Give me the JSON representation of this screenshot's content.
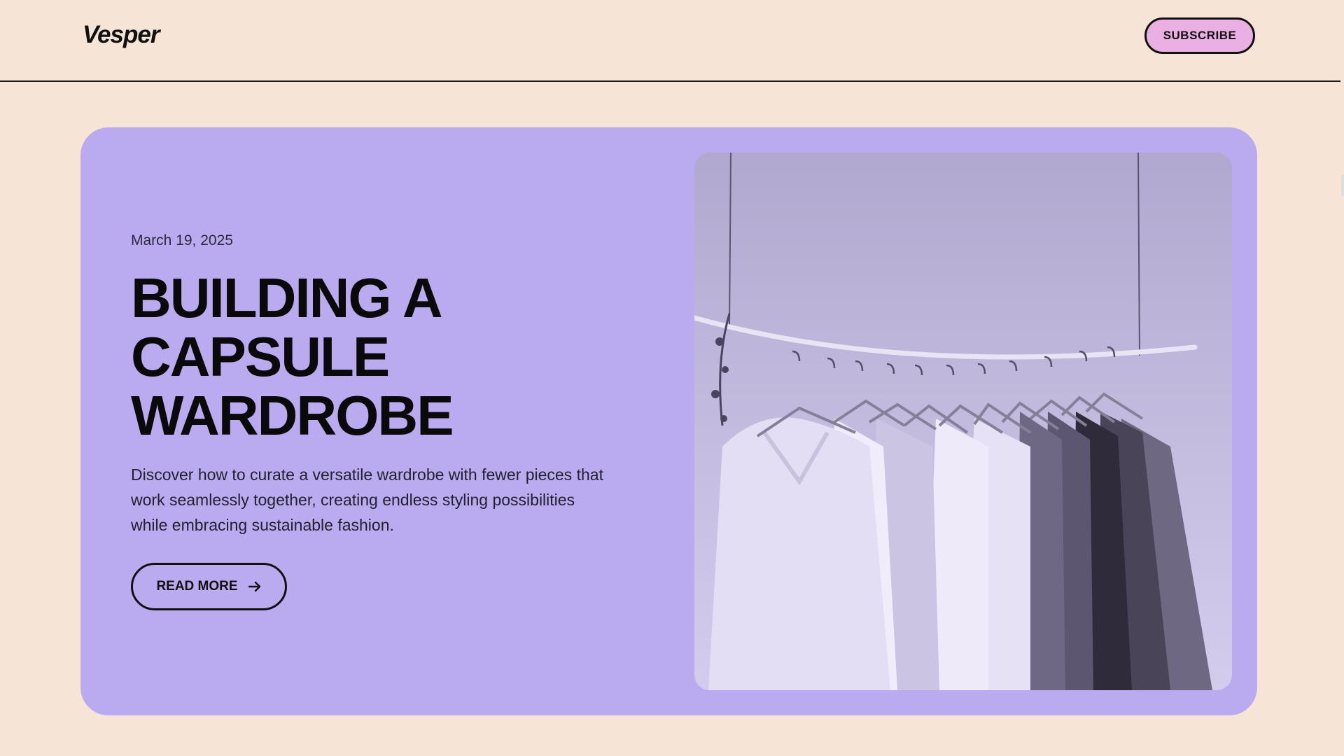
{
  "header": {
    "logo": "Vesper",
    "subscribe_label": "SUBSCRIBE"
  },
  "hero": {
    "date": "March 19, 2025",
    "title_lines": [
      "BUILDING A",
      "CAPSULE",
      "WARDROBE"
    ],
    "description": "Discover how to curate a versatile wardrobe with fewer pieces that work seamlessly together, creating endless styling possibilities while embracing sustainable fashion.",
    "read_more_label": "READ MORE",
    "image_icon": "clothes-rack-photo"
  },
  "colors": {
    "background": "#f6e5d6",
    "hero_card": "#baaaf0",
    "subscribe_button": "#eab0e4",
    "text": "#111111"
  }
}
